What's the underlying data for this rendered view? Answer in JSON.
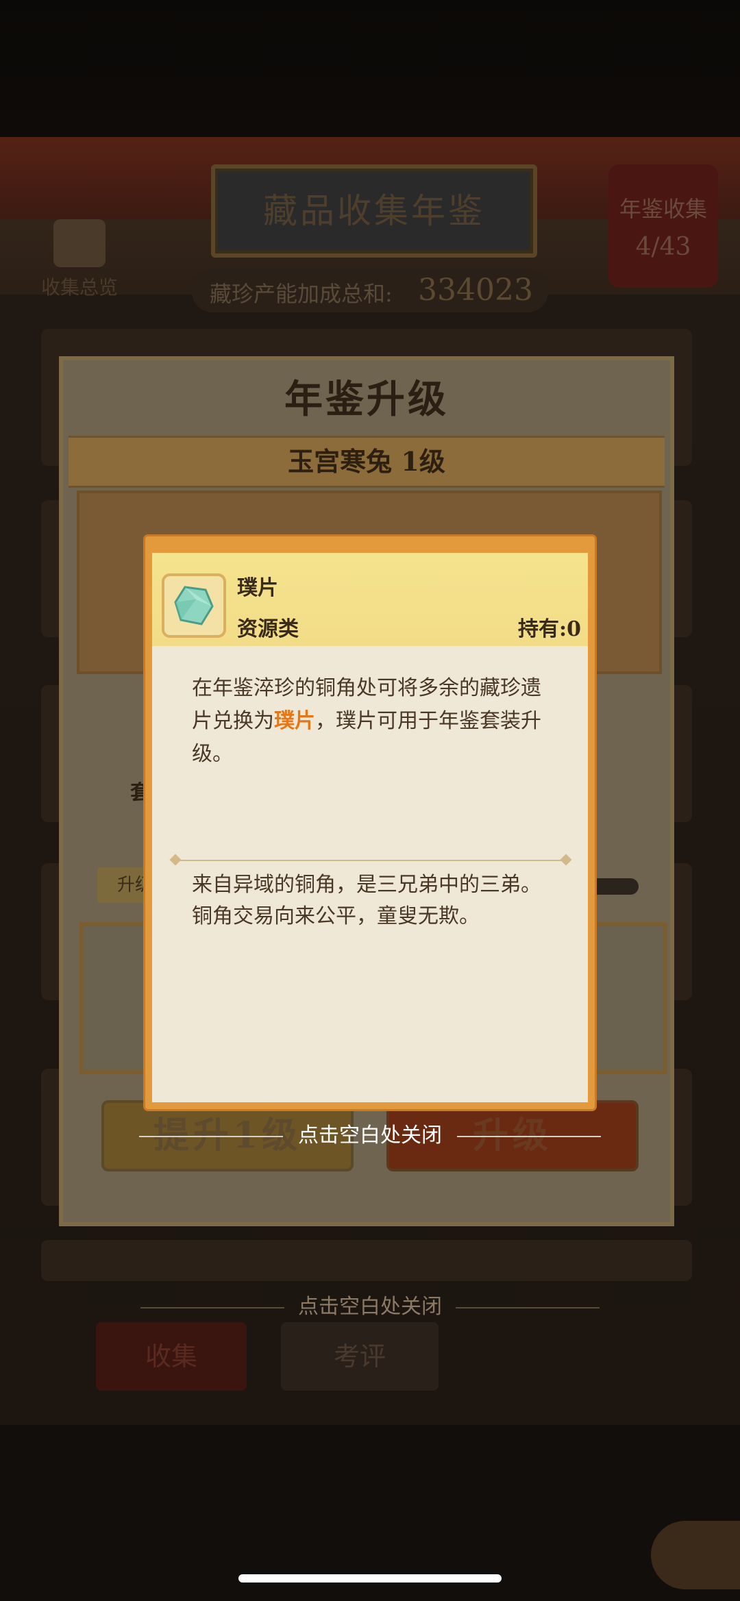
{
  "background": {
    "title": "藏品收集年鉴",
    "collect_label": "年鉴收集",
    "collect_count": "4/43",
    "overview_label": "收集总览",
    "bonus_label": "藏珍产能加成总和:",
    "bonus_value": "334023",
    "tabs": [
      "收集",
      "考评"
    ],
    "close_hint": "点击空白处关闭"
  },
  "upgrade_panel": {
    "title": "年鉴升级",
    "subtitle": "玉宫寒兔 1级",
    "side_char": "套",
    "level_tag": "升级",
    "btn_left": "提升1级",
    "btn_right": "升级"
  },
  "item_popup": {
    "name": "璞片",
    "category": "资源类",
    "hold_label": "持有:",
    "hold_value": "0",
    "desc_before": "在年鉴淬珍的铜角处可将多余的藏珍遗片兑换为",
    "desc_highlight": "璞片",
    "desc_after": "，璞片可用于年鉴套装升级。",
    "lore": "来自异域的铜角，是三兄弟中的三弟。铜角交易向来公平，童叟无欺。",
    "highlight_color": "#e3781a"
  },
  "close_hint": "点击空白处关闭"
}
